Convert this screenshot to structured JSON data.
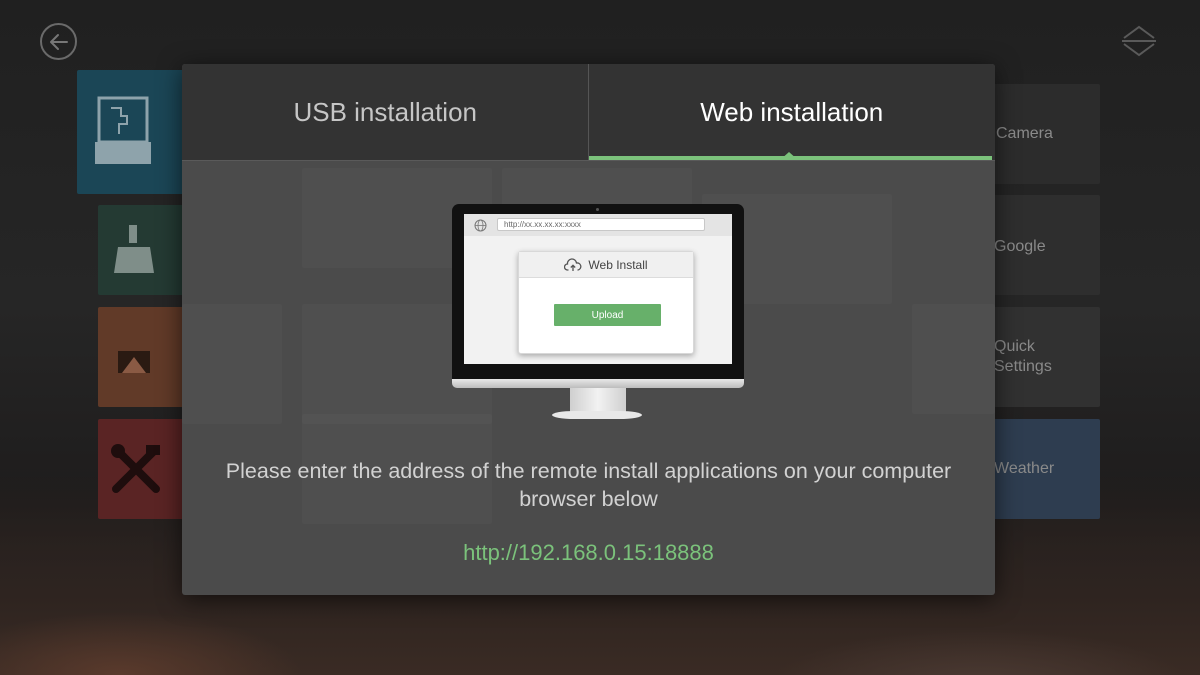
{
  "dialog": {
    "tabs": [
      {
        "label": "USB installation",
        "active": false
      },
      {
        "label": "Web installation",
        "active": true
      }
    ],
    "illustration": {
      "address_text": "http://xx.xx.xx.xx:xxxx",
      "panel_title": "Web Install",
      "upload_label": "Upload"
    },
    "instructions": "Please enter the address of the remote install applications on your computer browser below",
    "url": "http://192.168.0.15:18888"
  },
  "background": {
    "tiles_right": [
      {
        "label": "Camera"
      },
      {
        "label": "Google"
      },
      {
        "label": "Quick\nSettings"
      },
      {
        "label": "Weather"
      }
    ]
  },
  "colors": {
    "accent": "#7bc27b",
    "dialog_bg": "#4b4b4b",
    "tab_bar_bg": "#333333"
  },
  "icons": [
    "back-arrow-icon",
    "sort-icon",
    "usb-drive-icon",
    "cleaner-brush-icon",
    "android-apps-icon",
    "tools-icon",
    "globe-icon",
    "cloud-upload-icon"
  ]
}
